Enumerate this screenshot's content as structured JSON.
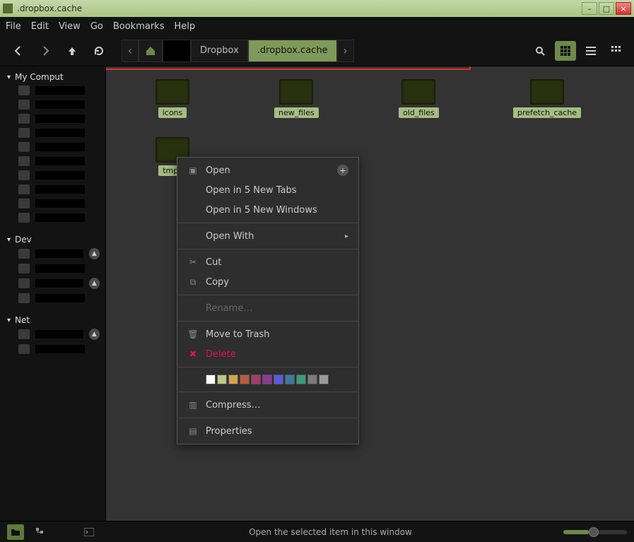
{
  "window": {
    "title": ".dropbox.cache"
  },
  "menubar": {
    "file": "File",
    "edit": "Edit",
    "view": "View",
    "go": "Go",
    "bookmarks": "Bookmarks",
    "help": "Help"
  },
  "breadcrumb": {
    "seg1": "Dropbox",
    "seg2": ".dropbox.cache"
  },
  "sidebar": {
    "computer": {
      "label": "My Comput"
    },
    "devices": {
      "label": "Dev"
    },
    "network": {
      "label": "Net"
    }
  },
  "folders": [
    {
      "name": "icons"
    },
    {
      "name": "new_files"
    },
    {
      "name": "old_files"
    },
    {
      "name": "prefetch_cache"
    },
    {
      "name": "tmp_"
    }
  ],
  "context_menu": {
    "open": "Open",
    "open_tabs": "Open in 5 New Tabs",
    "open_windows": "Open in 5 New Windows",
    "open_with": "Open With",
    "cut": "Cut",
    "copy": "Copy",
    "rename": "Rename…",
    "move_trash": "Move to Trash",
    "delete": "Delete",
    "compress": "Compress…",
    "properties": "Properties",
    "colors": [
      "#ffffff",
      "#b9c78a",
      "#d4a24a",
      "#b85c3a",
      "#a33a6a",
      "#8a3a9a",
      "#5a5adc",
      "#3a7aa0",
      "#3a9a7a",
      "#7a7a7a",
      "#9a9a9a"
    ]
  },
  "statusbar": {
    "message": "Open the selected item in this window"
  }
}
